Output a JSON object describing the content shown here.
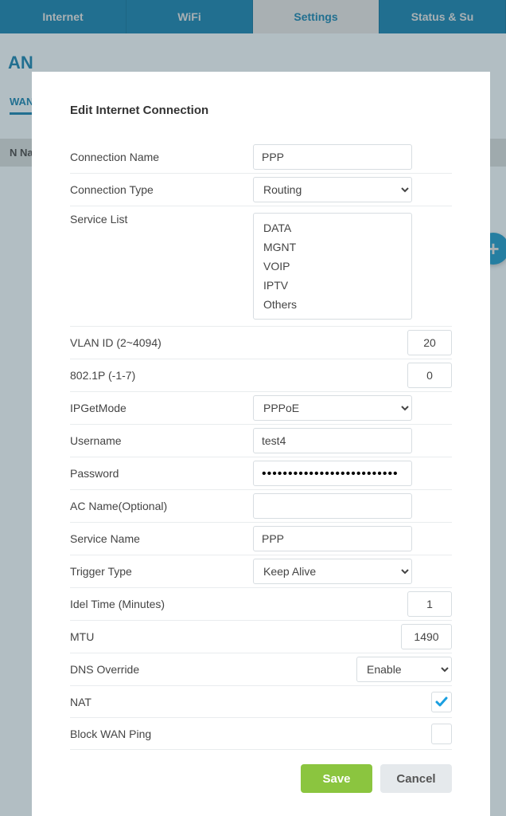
{
  "nav": {
    "items": [
      {
        "label": "Internet",
        "id": "internet"
      },
      {
        "label": "WiFi",
        "id": "wifi"
      },
      {
        "label": "Settings",
        "id": "settings",
        "active": true
      },
      {
        "label": "Status & Su",
        "id": "status"
      }
    ]
  },
  "page": {
    "title": "AN",
    "sidebar_wan": "WAN",
    "table_header_col1": "N Nam"
  },
  "fab_icon": "plus-icon",
  "modal": {
    "title": "Edit Internet Connection",
    "fields": {
      "connection_name": {
        "label": "Connection Name",
        "value": "PPP"
      },
      "connection_type": {
        "label": "Connection Type",
        "value": "Routing"
      },
      "service_list": {
        "label": "Service List",
        "options": [
          "DATA",
          "MGNT",
          "VOIP",
          "IPTV",
          "Others"
        ]
      },
      "vlan_id": {
        "label": "VLAN ID (2~4094)",
        "value": "20"
      },
      "p8021": {
        "label": "802.1P (-1-7)",
        "value": "0"
      },
      "ipgetmode": {
        "label": "IPGetMode",
        "value": "PPPoE"
      },
      "username": {
        "label": "Username",
        "value": "test4"
      },
      "password": {
        "label": "Password",
        "value": "••••••••••••••••••••••••••"
      },
      "ac_name": {
        "label": "AC Name(Optional)",
        "value": ""
      },
      "service_name": {
        "label": "Service Name",
        "value": "PPP"
      },
      "trigger_type": {
        "label": "Trigger Type",
        "value": "Keep Alive"
      },
      "idle_time": {
        "label": "Idel Time (Minutes)",
        "value": "1"
      },
      "mtu": {
        "label": "MTU",
        "value": "1490"
      },
      "dns_override": {
        "label": "DNS Override",
        "value": "Enable"
      },
      "nat": {
        "label": "NAT",
        "checked": true
      },
      "block_wan_ping": {
        "label": "Block WAN Ping",
        "checked": false
      }
    },
    "buttons": {
      "save": "Save",
      "cancel": "Cancel"
    }
  }
}
